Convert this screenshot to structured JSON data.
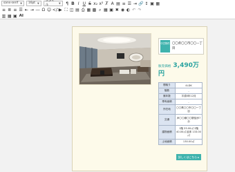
{
  "toolbar": {
    "font_family": "sans-serif",
    "font_size": "16pt",
    "style_label": "スタイル",
    "row1_icons": [
      "format-block-icon",
      "bold-icon",
      "italic-icon",
      "underline-icon",
      "strikethrough-icon",
      "subscript-icon",
      "superscript-icon",
      "remove-format-icon",
      "text-color-icon",
      "highlight-icon",
      "align-icon",
      "list-icon",
      "indent-icon",
      "link-icon",
      "unlink-icon",
      "line-height-icon",
      "image-icon",
      "table-icon"
    ],
    "row2_icons": [
      "align-left-icon",
      "align-center-icon",
      "align-right-icon",
      "justify-icon",
      "outdent-icon",
      "indent-more-icon",
      "hr-icon",
      "special-char-icon",
      "emoji-icon",
      "code-icon",
      "video-icon",
      "undo-icon",
      "redo-icon",
      "fullscreen-icon",
      "source-icon",
      "preview-icon",
      "print-icon",
      "template-icon",
      "block-icon",
      "find-icon",
      "replace-icon",
      "grid-icon",
      "paste-icon",
      "trash-icon",
      "redo-arrow-icon",
      "undo-arrow-icon"
    ],
    "ai_label": "AI"
  },
  "card": {
    "badge_text": "中古物件",
    "property_name": "〇〇県〇〇市〇〇一丁目",
    "price_label": "販売価格",
    "price_value": "3,490万",
    "price_unit": "円",
    "specs": [
      {
        "key": "間取り",
        "value": "4LDK"
      },
      {
        "key": "階数",
        "value": "-"
      },
      {
        "key": "築年数",
        "value": "平成8年12月"
      },
      {
        "key": "専有面積",
        "value": "-"
      },
      {
        "key": "所在地",
        "value": "〇〇県〇〇市〇〇一丁目"
      },
      {
        "key": "交通",
        "value": "JR〇〇線〇〇駅徒歩7分"
      },
      {
        "key": "建物面積",
        "value": "1階 33.00㎡ 2階 40.00㎡ 延床 133.00㎡"
      },
      {
        "key": "土地面積",
        "value": "130.00㎡"
      }
    ],
    "more_button": "詳しくはこちら ▸"
  }
}
